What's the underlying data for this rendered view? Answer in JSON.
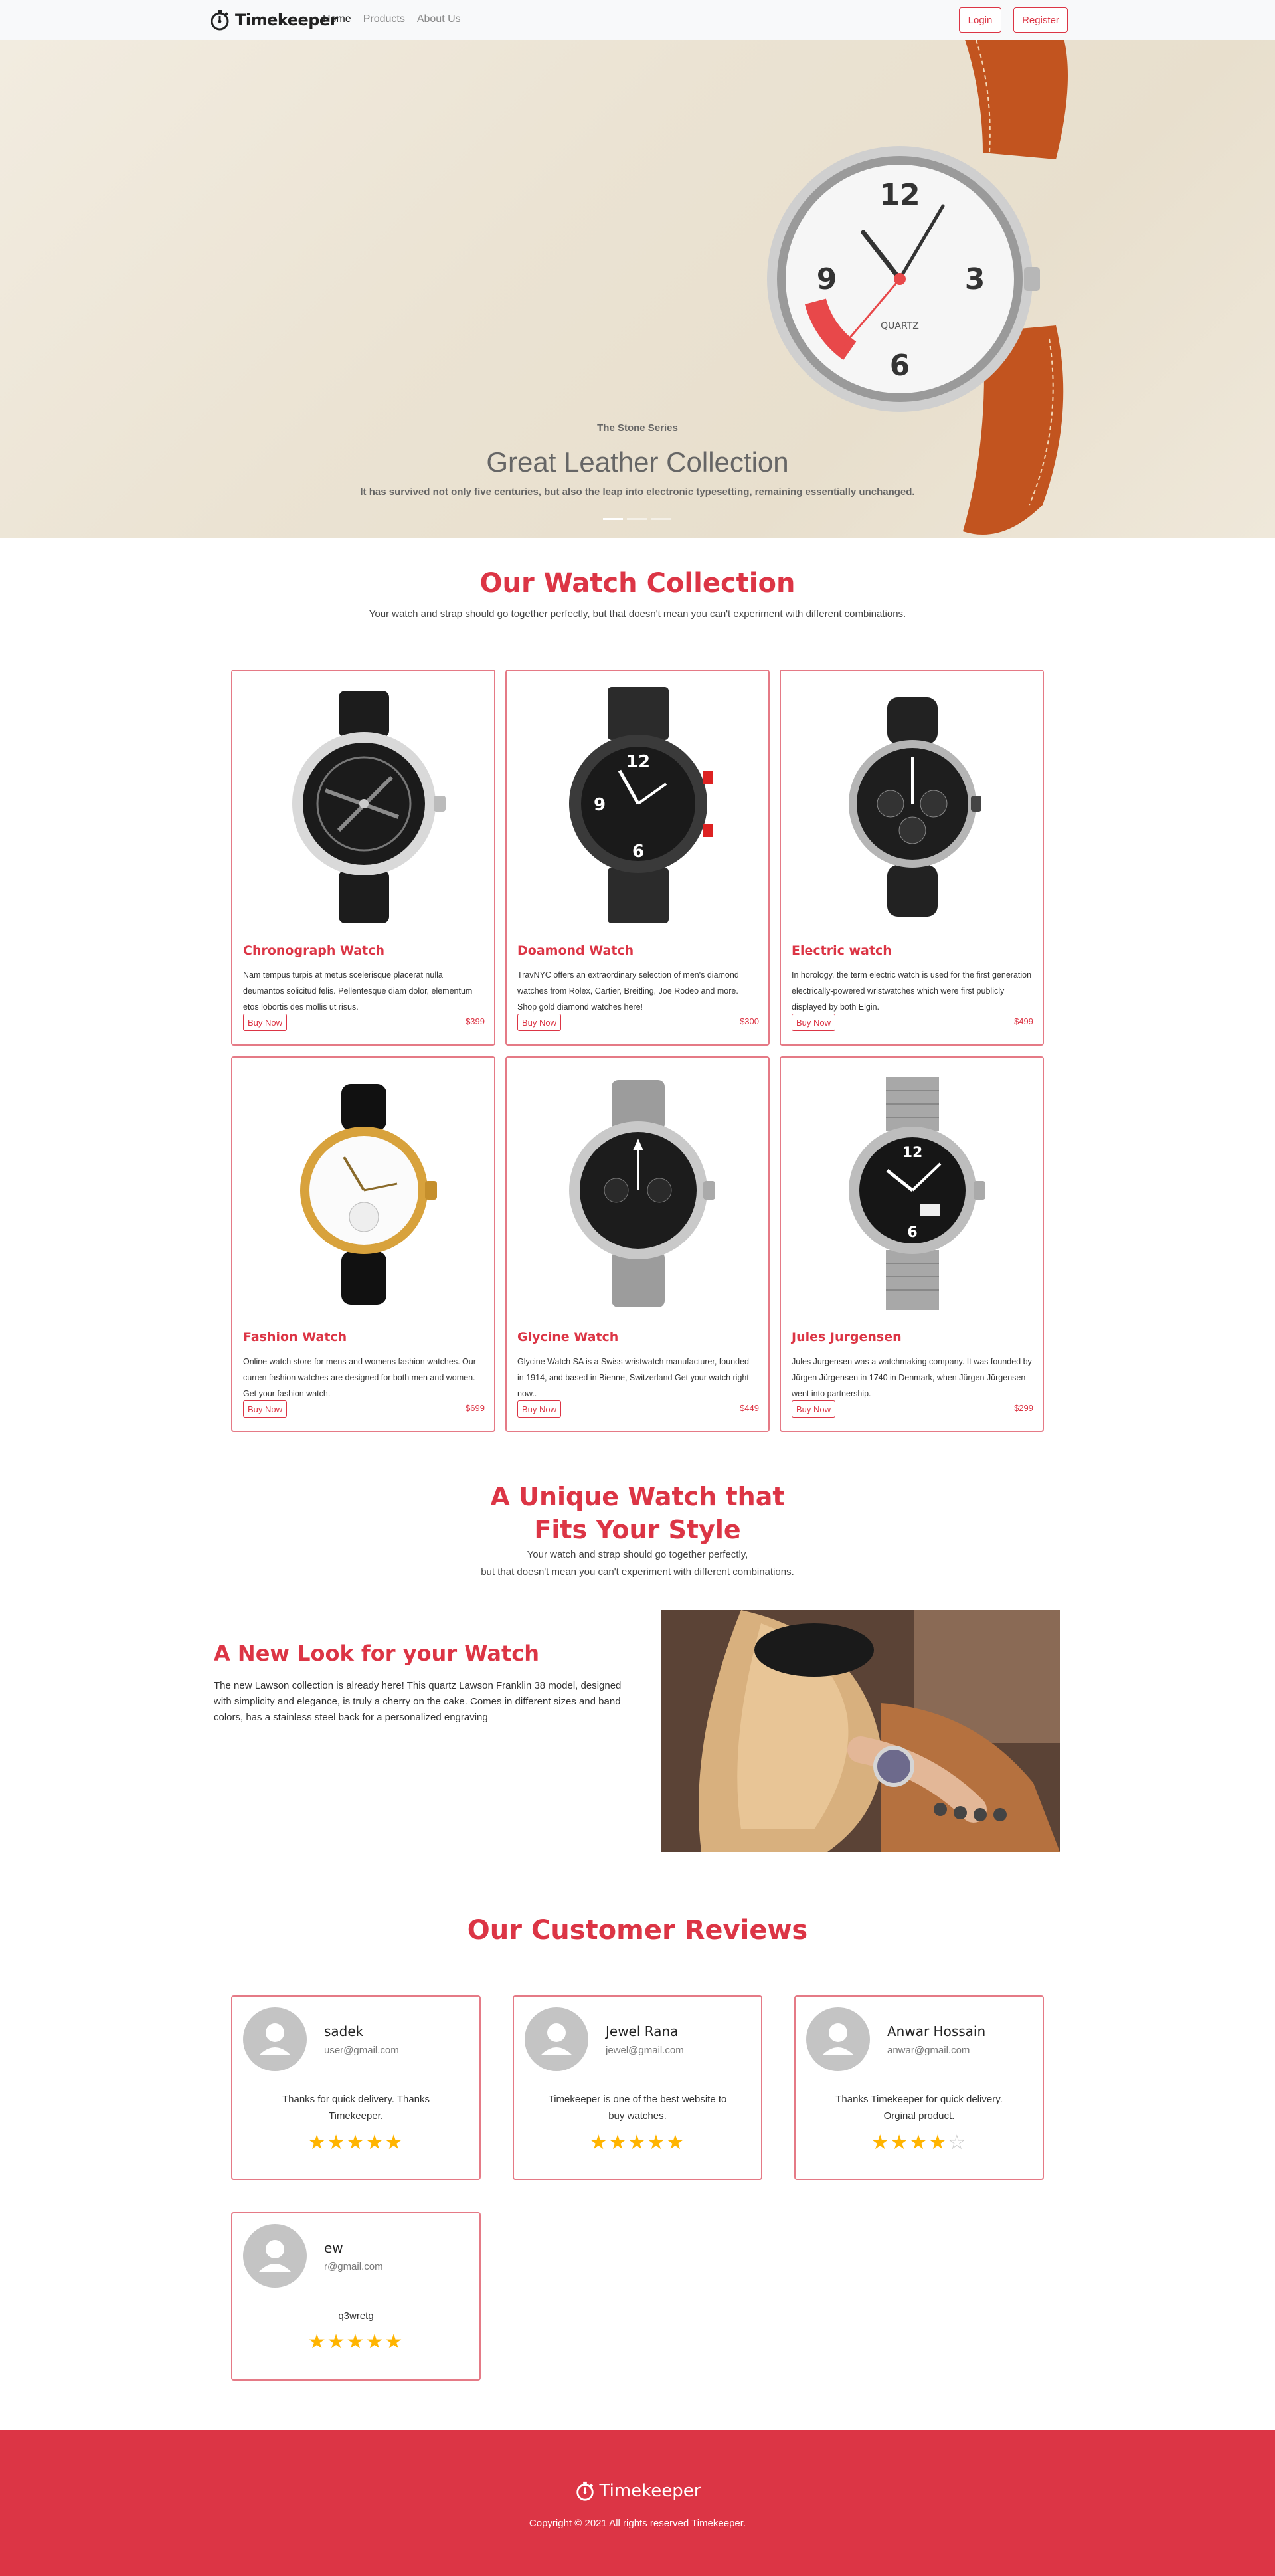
{
  "brand": {
    "name": "Timekeeper"
  },
  "nav": {
    "links": [
      {
        "label": "Home"
      },
      {
        "label": "Products"
      },
      {
        "label": "About Us"
      }
    ],
    "login_label": "Login",
    "register_label": "Register"
  },
  "hero": {
    "subtitle": "The Stone Series",
    "title": "Great Leather Collection",
    "description": "It has survived not only five centuries, but also the leap into electronic typesetting, remaining essentially unchanged.",
    "watch_dial_text": "QUARTZ"
  },
  "collection": {
    "title": "Our Watch Collection",
    "description": "Your watch and strap should go together perfectly, but that doesn't mean you can't experiment with different combinations.",
    "buy_label": "Buy Now",
    "products": [
      {
        "name": "Chronograph Watch",
        "description": "Nam tempus turpis at metus scelerisque placerat nulla deumantos solicitud felis. Pellentesque diam dolor, elementum etos lobortis des mollis ut risus.",
        "price": "$399"
      },
      {
        "name": "Doamond Watch",
        "description": "TravNYC offers an extraordinary selection of men's diamond watches from Rolex, Cartier, Breitling, Joe Rodeo and more. Shop gold diamond watches here!",
        "price": "$300"
      },
      {
        "name": "Electric watch",
        "description": "In horology, the term electric watch is used for the first generation electrically-powered wristwatches which were first publicly displayed by both Elgin.",
        "price": "$499"
      },
      {
        "name": "Fashion Watch",
        "description": "Online watch store for mens and womens fashion watches. Our curren fashion watches are designed for both men and women. Get your fashion watch.",
        "price": "$699"
      },
      {
        "name": "Glycine Watch",
        "description": "Glycine Watch SA is a Swiss wristwatch manufacturer, founded in 1914, and based in Bienne, Switzerland Get your watch right now..",
        "price": "$449"
      },
      {
        "name": "Jules Jurgensen",
        "description": "Jules Jurgensen was a watchmaking company. It was founded by Jürgen Jürgensen in 1740 in Denmark, when Jürgen Jürgensen went into partnership.",
        "price": "$299"
      }
    ]
  },
  "unique": {
    "title_line1": "A Unique Watch that",
    "title_line2": "Fits Your Style",
    "desc_line1": "Your watch and strap should go together perfectly,",
    "desc_line2": "but that doesn't mean you can't experiment with different combinations."
  },
  "feature": {
    "title": "A New Look for your Watch",
    "text": "The new Lawson collection is already here! This quartz Lawson Franklin 38 model, designed with simplicity and elegance, is truly a cherry on the cake. Comes in different sizes and band colors, has a stainless steel back for a personalized engraving"
  },
  "reviews": {
    "title": "Our Customer Reviews",
    "items": [
      {
        "name": "sadek",
        "email": "user@gmail.com",
        "text": "Thanks for quick delivery. Thanks Timekeeper.",
        "rating": 5
      },
      {
        "name": "Jewel Rana",
        "email": "jewel@gmail.com",
        "text": "Timekeeper is one of the best website to buy watches.",
        "rating": 5
      },
      {
        "name": "Anwar Hossain",
        "email": "anwar@gmail.com",
        "text": "Thanks Timekeeper for quick delivery. Orginal product.",
        "rating": 4
      },
      {
        "name": "ew",
        "email": "r@gmail.com",
        "text": "q3wretg",
        "rating": 5
      }
    ]
  },
  "footer": {
    "brand": "Timekeeper",
    "copyright": "Copyright © 2021 All rights reserved Timekeeper."
  },
  "colors": {
    "accent": "#dc3545",
    "star": "#ffb400",
    "star_empty": "#c8c8c8"
  },
  "icons": {
    "logo": "stopwatch-icon",
    "avatar": "user-avatar-icon",
    "star": "star-icon"
  }
}
